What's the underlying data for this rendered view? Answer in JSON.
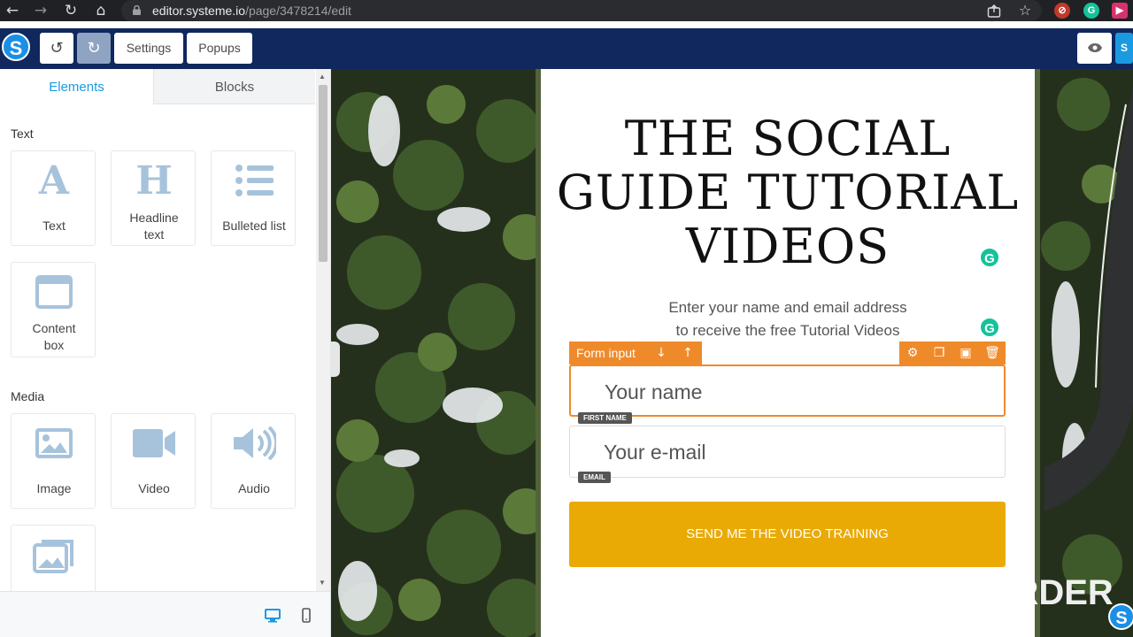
{
  "browser": {
    "url_host": "editor.systeme.io",
    "url_path": "/page/3478214/edit"
  },
  "toolbar": {
    "logo_letter": "S",
    "settings_label": "Settings",
    "popups_label": "Popups",
    "right_badge": "S"
  },
  "sidebar": {
    "tabs": [
      {
        "label": "Elements",
        "active": true
      },
      {
        "label": "Blocks",
        "active": false
      }
    ],
    "sections": {
      "text": {
        "title": "Text",
        "items": [
          {
            "label": "Text",
            "icon": "letter-a-icon"
          },
          {
            "label": "Headline text",
            "icon": "letter-h-icon"
          },
          {
            "label": "Bulleted list",
            "icon": "list-icon"
          },
          {
            "label": "Content box",
            "icon": "window-icon"
          }
        ]
      },
      "media": {
        "title": "Media",
        "items": [
          {
            "label": "Image",
            "icon": "image-icon"
          },
          {
            "label": "Video",
            "icon": "video-camera-icon"
          },
          {
            "label": "Audio",
            "icon": "speaker-icon"
          },
          {
            "label": "",
            "icon": "gallery-icon"
          }
        ]
      }
    }
  },
  "page": {
    "headline": "THE SOCIAL GUIDE TUTORIAL VIDEOS",
    "subtext_line1": "Enter your name and email address",
    "subtext_line2": "to receive the free Tutorial Videos",
    "form_input_label": "Form input",
    "name_placeholder": "Your name",
    "name_tag": "FIRST NAME",
    "email_placeholder": "Your e-mail",
    "email_tag": "EMAIL",
    "cta_label": "SEND ME THE VIDEO TRAINING"
  },
  "watermark": {
    "text": "DU RECORDER"
  },
  "colors": {
    "toolbar_bg": "#10285e",
    "accent_blue": "#1b9ae0",
    "form_orange": "#ef8a2b",
    "cta_yellow": "#eaaa05",
    "grammarly_green": "#15c39a"
  }
}
